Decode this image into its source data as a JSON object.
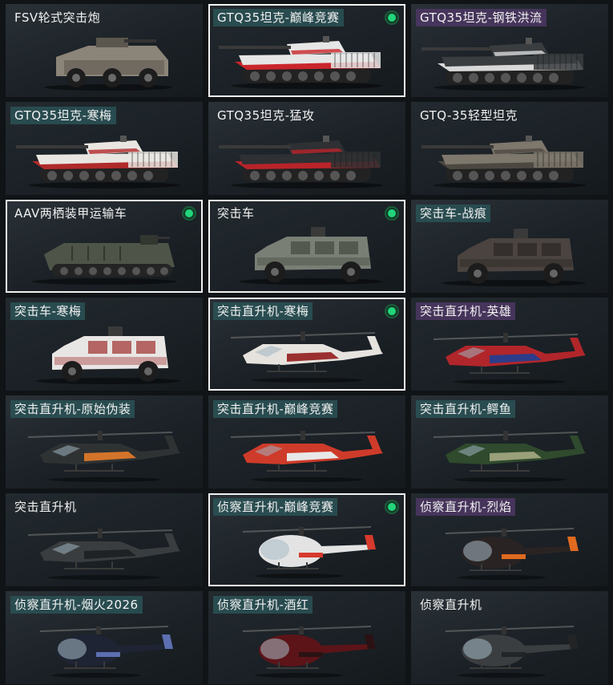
{
  "items": [
    {
      "name": "FSV轮式突击炮",
      "kind": "wheeled",
      "tag": "none",
      "selected": false,
      "equipped": false,
      "colors": [
        "#8b8478",
        "#5b564e"
      ]
    },
    {
      "name": "GTQ35坦克-巅峰竞赛",
      "kind": "tank",
      "tag": "green",
      "selected": true,
      "equipped": true,
      "colors": [
        "#e6e6e6",
        "#c9252b"
      ]
    },
    {
      "name": "GTQ35坦克-钢铁洪流",
      "kind": "tank",
      "tag": "purple",
      "selected": false,
      "equipped": false,
      "colors": [
        "#3a3d40",
        "#d8d8d8"
      ]
    },
    {
      "name": "GTQ35坦克-寒梅",
      "kind": "tank",
      "tag": "green",
      "selected": false,
      "equipped": false,
      "colors": [
        "#e9e6e2",
        "#b02a2a"
      ]
    },
    {
      "name": "GTQ35坦克-猛攻",
      "kind": "tank",
      "tag": "none",
      "selected": false,
      "equipped": false,
      "colors": [
        "#2e3033",
        "#b8242a"
      ]
    },
    {
      "name": "GTQ-35轻型坦克",
      "kind": "tank",
      "tag": "none",
      "selected": false,
      "equipped": false,
      "colors": [
        "#7d776c",
        "#4c4841"
      ]
    },
    {
      "name": "AAV两栖装甲运输车",
      "kind": "aav",
      "tag": "none",
      "selected": true,
      "equipped": true,
      "colors": [
        "#4e5548",
        "#32372f"
      ]
    },
    {
      "name": "突击车",
      "kind": "truck",
      "tag": "none",
      "selected": true,
      "equipped": true,
      "colors": [
        "#7a7f76",
        "#44483f"
      ]
    },
    {
      "name": "突击车-战痕",
      "kind": "truck",
      "tag": "green",
      "selected": false,
      "equipped": false,
      "colors": [
        "#4a4340",
        "#2b2624"
      ]
    },
    {
      "name": "突击车-寒梅",
      "kind": "truck",
      "tag": "green",
      "selected": false,
      "equipped": false,
      "colors": [
        "#e8e6e4",
        "#9e2e2e"
      ]
    },
    {
      "name": "突击直升机-寒梅",
      "kind": "heli",
      "tag": "green",
      "selected": true,
      "equipped": true,
      "colors": [
        "#e6e3df",
        "#9b3030"
      ]
    },
    {
      "name": "突击直升机-英雄",
      "kind": "heli",
      "tag": "purple",
      "selected": false,
      "equipped": false,
      "colors": [
        "#b1262a",
        "#2c3c8a"
      ]
    },
    {
      "name": "突击直升机-原始伪装",
      "kind": "heli",
      "tag": "green",
      "selected": false,
      "equipped": false,
      "colors": [
        "#2f3233",
        "#d3742a"
      ]
    },
    {
      "name": "突击直升机-巅峰竞赛",
      "kind": "heli",
      "tag": "green",
      "selected": false,
      "equipped": false,
      "colors": [
        "#cf3b2a",
        "#e8e8e8"
      ]
    },
    {
      "name": "突击直升机-鳄鱼",
      "kind": "heli",
      "tag": "green",
      "selected": false,
      "equipped": false,
      "colors": [
        "#2f4a2d",
        "#9aa07a"
      ]
    },
    {
      "name": "突击直升机",
      "kind": "heli",
      "tag": "none",
      "selected": false,
      "equipped": false,
      "colors": [
        "#3a3d3f",
        "#1f2224"
      ]
    },
    {
      "name": "侦察直升机-巅峰竞赛",
      "kind": "scout",
      "tag": "green",
      "selected": true,
      "equipped": true,
      "colors": [
        "#e3e3e3",
        "#d63a2d"
      ]
    },
    {
      "name": "侦察直升机-烈焰",
      "kind": "scout",
      "tag": "purple",
      "selected": false,
      "equipped": false,
      "colors": [
        "#2a2323",
        "#e06a20"
      ]
    },
    {
      "name": "侦察直升机-烟火2026",
      "kind": "scout",
      "tag": "green",
      "selected": false,
      "equipped": false,
      "colors": [
        "#1e2433",
        "#5c6fb0"
      ]
    },
    {
      "name": "侦察直升机-酒红",
      "kind": "scout",
      "tag": "green",
      "selected": false,
      "equipped": false,
      "colors": [
        "#5c1418",
        "#2a1214"
      ]
    },
    {
      "name": "侦察直升机",
      "kind": "scout",
      "tag": "none",
      "selected": false,
      "equipped": false,
      "colors": [
        "#3b3e40",
        "#222426"
      ]
    }
  ]
}
